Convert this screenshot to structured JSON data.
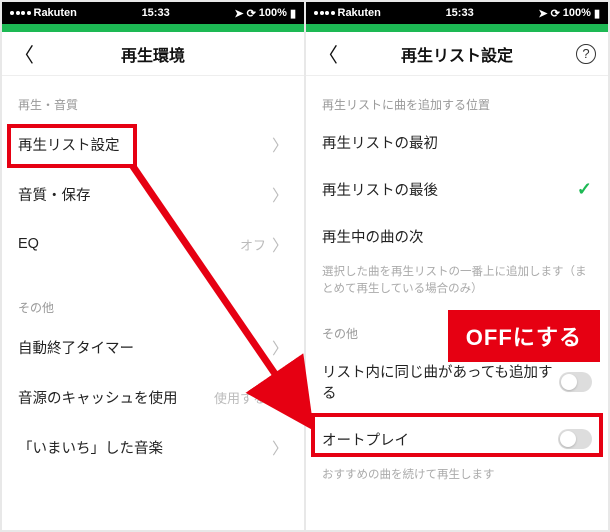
{
  "status": {
    "carrier": "Rakuten",
    "time": "15:33",
    "battery": "100%",
    "nav_icon": "◪"
  },
  "left": {
    "title": "再生環境",
    "section1": "再生・音質",
    "row_playlist": "再生リスト設定",
    "row_quality": "音質・保存",
    "row_eq": "EQ",
    "row_eq_val": "オフ",
    "section2": "その他",
    "row_timer": "自動終了タイマー",
    "row_cache": "音源のキャッシュを使用",
    "row_cache_val": "使用する",
    "row_imachi": "「いまいち」した音楽"
  },
  "right": {
    "title": "再生リスト設定",
    "section1": "再生リストに曲を追加する位置",
    "opt_first": "再生リストの最初",
    "opt_last": "再生リストの最後",
    "opt_next": "再生中の曲の次",
    "caption1": "選択した曲を再生リストの一番上に追加します（まとめて再生している場合のみ）",
    "section2": "その他",
    "row_dup": "リスト内に同じ曲があっても追加する",
    "row_autoplay": "オートプレイ",
    "caption2": "おすすめの曲を続けて再生します"
  },
  "annotation": {
    "off_label": "OFFにする"
  }
}
